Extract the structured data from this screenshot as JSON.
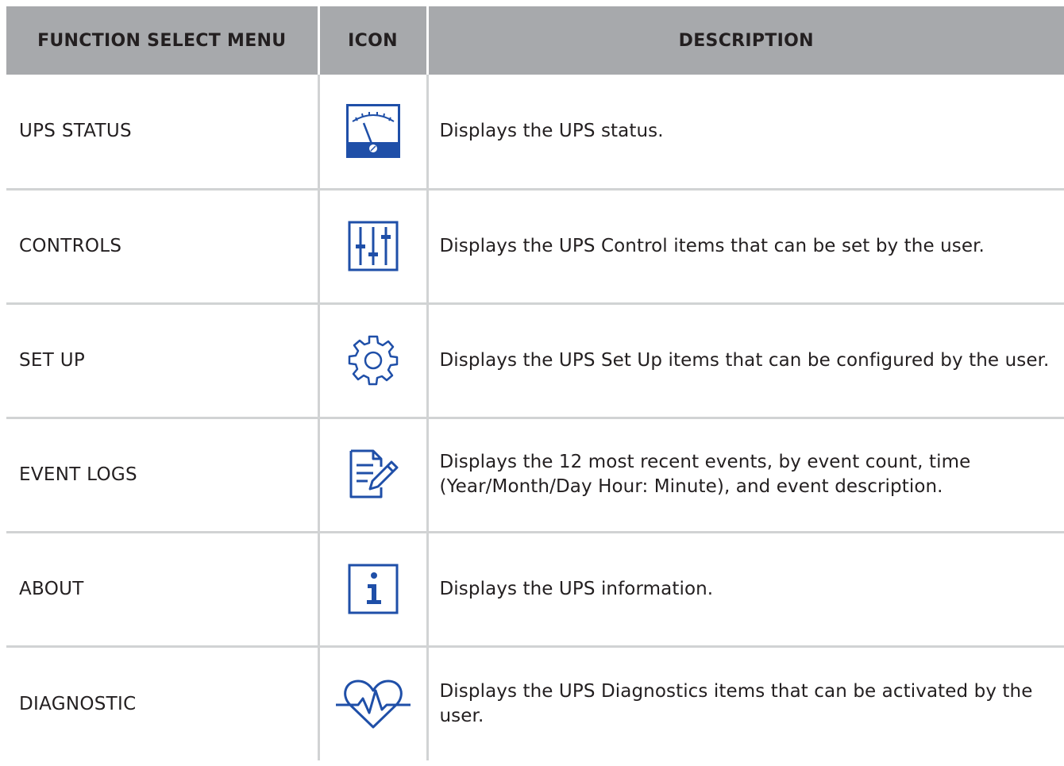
{
  "header": {
    "col_function": "FUNCTION SELECT MENU",
    "col_icon": "ICON",
    "col_description": "DESCRIPTION"
  },
  "rows": [
    {
      "function": "UPS STATUS",
      "icon": "gauge-meter-icon",
      "description": "Displays the UPS status."
    },
    {
      "function": "CONTROLS",
      "icon": "sliders-icon",
      "description": "Displays the UPS Control items that can be set by the user."
    },
    {
      "function": "SET UP",
      "icon": "gear-icon",
      "description": "Displays the UPS Set Up items that can be configured by the user."
    },
    {
      "function": "EVENT LOGS",
      "icon": "document-edit-icon",
      "description": "Displays the 12 most recent events, by event count, time (Year/Month/Day Hour: Minute), and event description."
    },
    {
      "function": "ABOUT",
      "icon": "info-icon",
      "description": "Displays the UPS information."
    },
    {
      "function": "DIAGNOSTIC",
      "icon": "heart-pulse-icon",
      "description": "Displays the UPS Diagnostics items that can be activated by the user."
    }
  ],
  "colors": {
    "icon_blue": "#1f4fa8",
    "header_gray": "#a7a9ac",
    "rule_gray": "#d1d3d4"
  }
}
